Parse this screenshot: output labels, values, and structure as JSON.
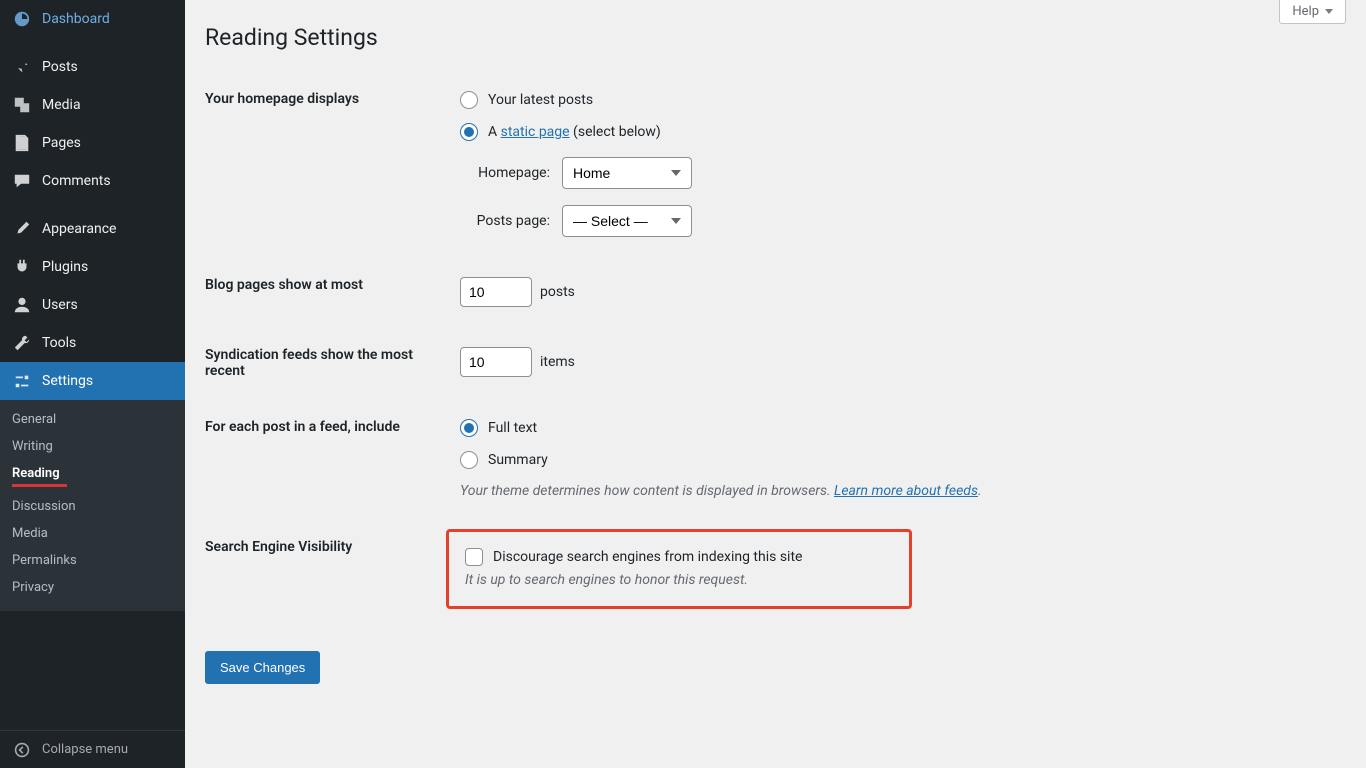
{
  "help": {
    "label": "Help"
  },
  "sidebar": {
    "items": [
      {
        "label": "Dashboard",
        "name": "sidebar-item-dashboard"
      },
      {
        "label": "Posts",
        "name": "sidebar-item-posts"
      },
      {
        "label": "Media",
        "name": "sidebar-item-media"
      },
      {
        "label": "Pages",
        "name": "sidebar-item-pages"
      },
      {
        "label": "Comments",
        "name": "sidebar-item-comments"
      },
      {
        "label": "Appearance",
        "name": "sidebar-item-appearance"
      },
      {
        "label": "Plugins",
        "name": "sidebar-item-plugins"
      },
      {
        "label": "Users",
        "name": "sidebar-item-users"
      },
      {
        "label": "Tools",
        "name": "sidebar-item-tools"
      },
      {
        "label": "Settings",
        "name": "sidebar-item-settings"
      }
    ],
    "submenu": [
      {
        "label": "General"
      },
      {
        "label": "Writing"
      },
      {
        "label": "Reading",
        "active": true
      },
      {
        "label": "Discussion"
      },
      {
        "label": "Media"
      },
      {
        "label": "Permalinks"
      },
      {
        "label": "Privacy"
      }
    ],
    "collapse_label": "Collapse menu"
  },
  "page": {
    "title": "Reading Settings",
    "save_button": "Save Changes"
  },
  "homepage": {
    "row_label": "Your homepage displays",
    "option_latest": "Your latest posts",
    "option_static_prefix": "A ",
    "option_static_link": "static page",
    "option_static_suffix": " (select below)",
    "homepage_label": "Homepage:",
    "homepage_value": "Home",
    "postspage_label": "Posts page:",
    "postspage_value": "— Select —"
  },
  "blog_pages": {
    "row_label": "Blog pages show at most",
    "value": "10",
    "unit": "posts"
  },
  "syndication": {
    "row_label": "Syndication feeds show the most recent",
    "value": "10",
    "unit": "items"
  },
  "feed_include": {
    "row_label": "For each post in a feed, include",
    "option_full": "Full text",
    "option_summary": "Summary",
    "desc_prefix": "Your theme determines how content is displayed in browsers. ",
    "desc_link": "Learn more about feeds",
    "desc_suffix": "."
  },
  "search_visibility": {
    "row_label": "Search Engine Visibility",
    "checkbox_label": "Discourage search engines from indexing this site",
    "desc": "It is up to search engines to honor this request."
  }
}
